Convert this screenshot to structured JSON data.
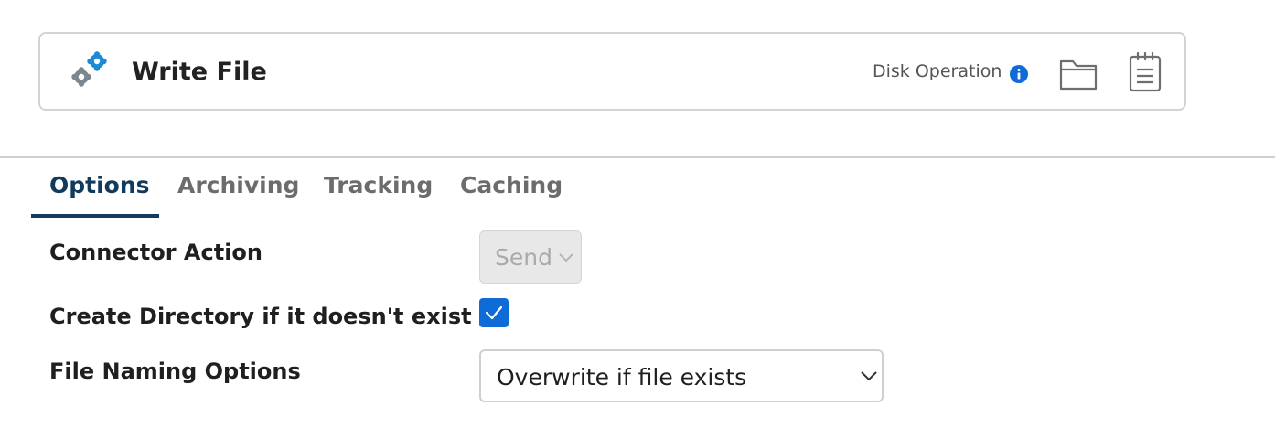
{
  "header": {
    "title": "Write File",
    "operation_type": "Disk Operation",
    "icons": {
      "logo": "gears-icon",
      "info": "info-icon",
      "folder": "folder-icon",
      "notes": "notepad-icon"
    },
    "colors": {
      "logo_blue": "#1a8ad9",
      "logo_gray": "#7d8790",
      "info_blue": "#0f6bd6"
    }
  },
  "tabs": [
    {
      "label": "Options",
      "active": true
    },
    {
      "label": "Archiving",
      "active": false
    },
    {
      "label": "Tracking",
      "active": false
    },
    {
      "label": "Caching",
      "active": false
    }
  ],
  "form": {
    "connector_action": {
      "label": "Connector Action",
      "value": "Send",
      "disabled": true
    },
    "create_directory": {
      "label": "Create Directory if it doesn't exist",
      "checked": true
    },
    "file_naming": {
      "label": "File Naming Options",
      "value": "Overwrite if file exists"
    }
  },
  "colors": {
    "accent": "#0f6bd6",
    "tab_active": "#123a5f",
    "tab_inactive": "#6c6c6c"
  }
}
